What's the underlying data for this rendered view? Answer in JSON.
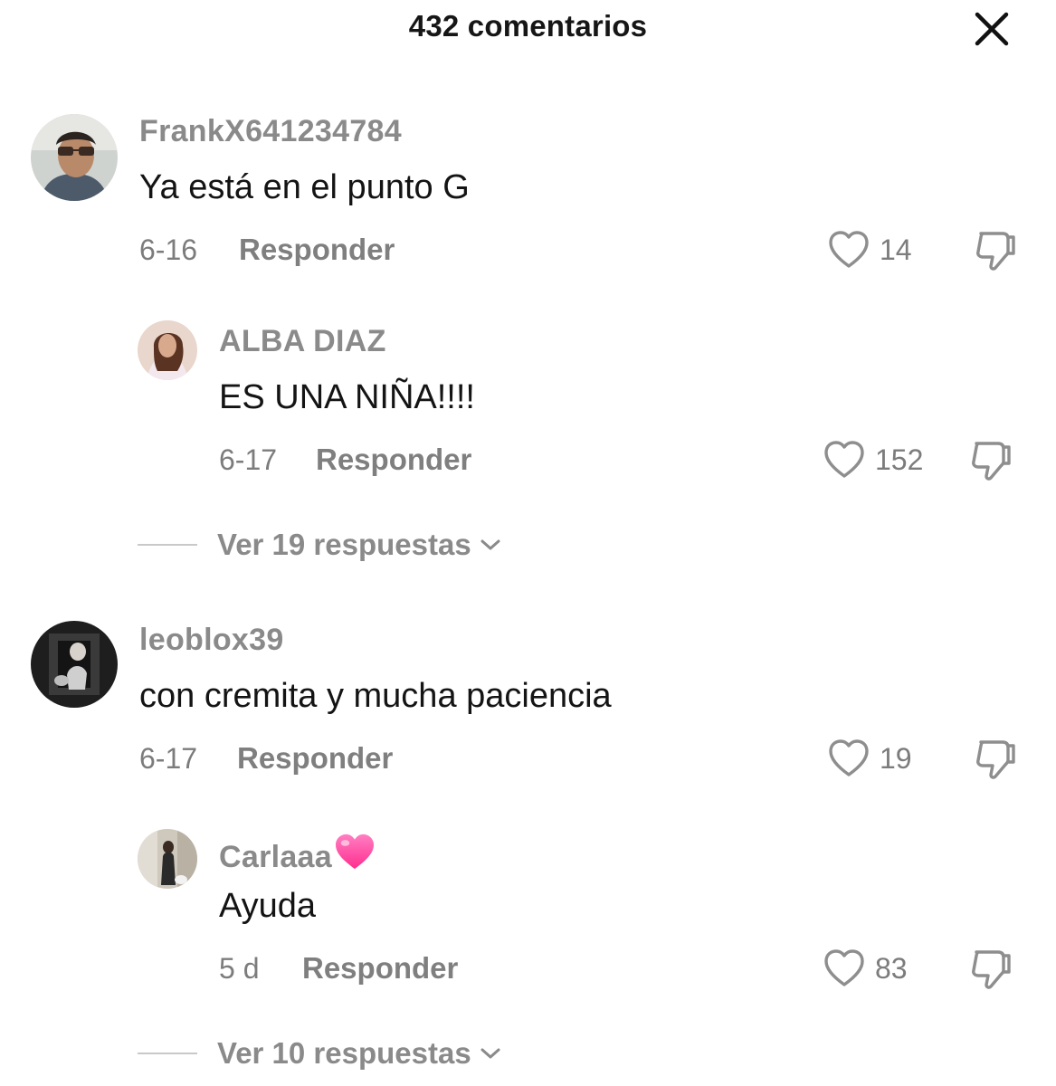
{
  "header": {
    "title": "432 comentarios",
    "close_icon": "close-icon"
  },
  "comments": [
    {
      "username": "FrankX641234784",
      "text": "Ya está en el punto G",
      "date": "6-16",
      "reply_label": "Responder",
      "likes": "14"
    },
    {
      "username": "ALBA DIAZ",
      "text": "ES UNA NIÑA!!!!",
      "date": "6-17",
      "reply_label": "Responder",
      "likes": "152"
    },
    {
      "username": "leoblox39",
      "text": "con cremita y mucha paciencia",
      "date": "6-17",
      "reply_label": "Responder",
      "likes": "19"
    },
    {
      "username": "Carlaaa",
      "text": "Ayuda",
      "date": "5 d",
      "reply_label": "Responder",
      "likes": "83"
    }
  ],
  "view_replies": [
    {
      "label": "Ver 19 respuestas"
    },
    {
      "label": "Ver 10 respuestas"
    }
  ],
  "colors": {
    "heart_emoji": "#ff4fa0",
    "muted_text": "#8a8a8a"
  }
}
